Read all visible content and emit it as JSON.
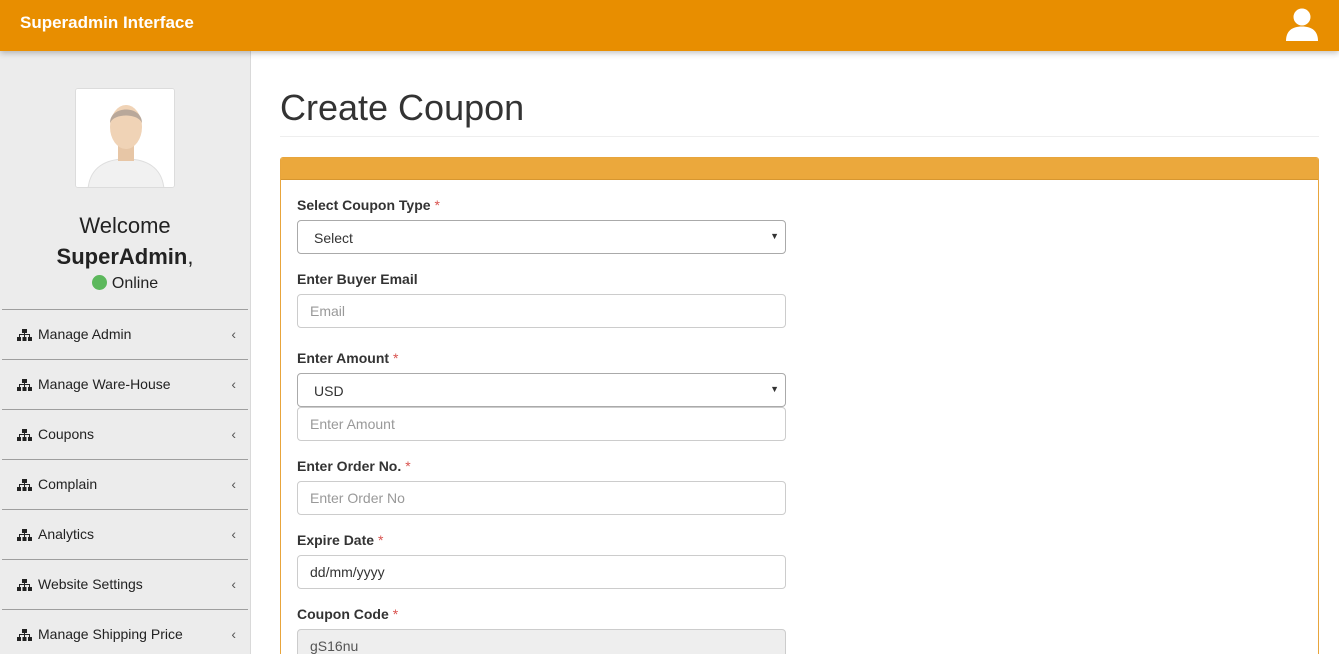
{
  "header": {
    "brand": "Superadmin Interface",
    "user_icon": "user-icon",
    "color": "#e88e00"
  },
  "sidebar": {
    "welcome": "Welcome",
    "username": "SuperAdmin",
    "username_suffix": ",",
    "status": "Online",
    "status_color": "#5cb85c",
    "items": [
      {
        "label": "Manage Admin",
        "icon": "sitemap-icon"
      },
      {
        "label": "Manage Ware-House",
        "icon": "sitemap-icon"
      },
      {
        "label": "Coupons",
        "icon": "sitemap-icon"
      },
      {
        "label": "Complain",
        "icon": "sitemap-icon"
      },
      {
        "label": "Analytics",
        "icon": "sitemap-icon"
      },
      {
        "label": "Website Settings",
        "icon": "sitemap-icon"
      },
      {
        "label": "Manage Shipping Price",
        "icon": "sitemap-icon"
      }
    ]
  },
  "main": {
    "title": "Create Coupon",
    "form": {
      "coupon_type_label": "Select Coupon Type",
      "coupon_type_value": "Select",
      "email_label": "Enter Buyer Email",
      "email_placeholder": "Email",
      "amount_label": "Enter Amount",
      "currency_value": "USD",
      "amount_placeholder": "Enter Amount",
      "order_label": "Enter Order No.",
      "order_placeholder": "Enter Order No",
      "expire_label": "Expire Date",
      "expire_placeholder": "dd/mm/yyyy",
      "code_label": "Coupon Code",
      "code_value": "gS16nu",
      "required_mark": "*"
    }
  }
}
